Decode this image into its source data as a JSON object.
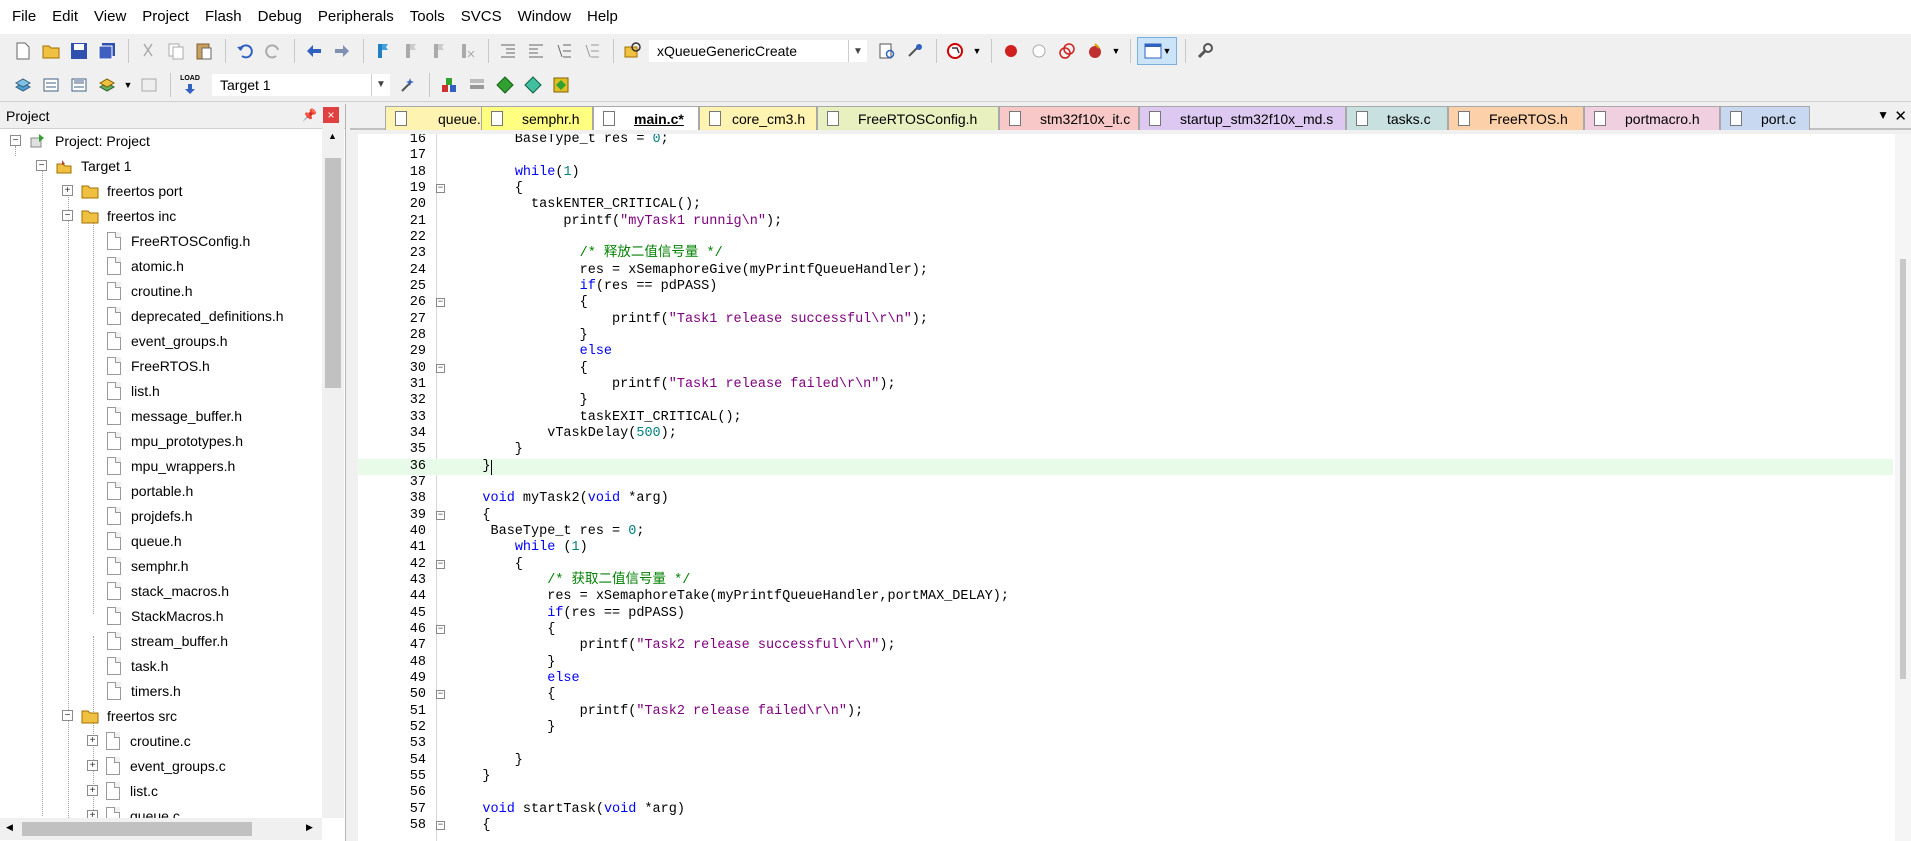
{
  "menu": [
    "File",
    "Edit",
    "View",
    "Project",
    "Flash",
    "Debug",
    "Peripherals",
    "Tools",
    "SVCS",
    "Window",
    "Help"
  ],
  "toolbar1": {
    "find_combo": "xQueueGenericCreate"
  },
  "toolbar2": {
    "target_combo": "Target 1",
    "load_label": "LOAD"
  },
  "project": {
    "title": "Project",
    "root": "Project: Project",
    "target": "Target 1",
    "folders": {
      "port": "freertos port",
      "inc": "freertos inc",
      "src": "freertos src"
    },
    "inc_files": [
      "FreeRTOSConfig.h",
      "atomic.h",
      "croutine.h",
      "deprecated_definitions.h",
      "event_groups.h",
      "FreeRTOS.h",
      "list.h",
      "message_buffer.h",
      "mpu_prototypes.h",
      "mpu_wrappers.h",
      "portable.h",
      "projdefs.h",
      "queue.h",
      "semphr.h",
      "stack_macros.h",
      "StackMacros.h",
      "stream_buffer.h",
      "task.h",
      "timers.h"
    ],
    "src_files": [
      "croutine.c",
      "event_groups.c",
      "list.c",
      "queue.c"
    ]
  },
  "tabs": [
    {
      "label": "queue.c",
      "color": "#fef3b0"
    },
    {
      "label": "semphr.h",
      "color": "#fefe80"
    },
    {
      "label": "main.c*",
      "color": "#ffffff"
    },
    {
      "label": "core_cm3.h",
      "color": "#fef3b0"
    },
    {
      "label": "FreeRTOSConfig.h",
      "color": "#e8f0c0"
    },
    {
      "label": "stm32f10x_it.c",
      "color": "#f8c8c8"
    },
    {
      "label": "startup_stm32f10x_md.s",
      "color": "#dcc8f0"
    },
    {
      "label": "tasks.c",
      "color": "#c8e0e0"
    },
    {
      "label": "FreeRTOS.h",
      "color": "#fcd0a8"
    },
    {
      "label": "portmacro.h",
      "color": "#f0d0e0"
    },
    {
      "label": "port.c",
      "color": "#c8d8f0"
    }
  ],
  "code": [
    {
      "n": "16",
      "t": "        BaseType_t res = 0;"
    },
    {
      "n": "17",
      "t": ""
    },
    {
      "n": "18",
      "t": "        while(1)"
    },
    {
      "n": "19",
      "t": "        {",
      "fold": true
    },
    {
      "n": "20",
      "t": "          taskENTER_CRITICAL();"
    },
    {
      "n": "21",
      "t": "              printf(\"myTask1 runnig\\n\");"
    },
    {
      "n": "22",
      "t": ""
    },
    {
      "n": "23",
      "t": "                /* 释放二值信号量 */"
    },
    {
      "n": "24",
      "t": "                res = xSemaphoreGive(myPrintfQueueHandler);"
    },
    {
      "n": "25",
      "t": "                if(res == pdPASS)"
    },
    {
      "n": "26",
      "t": "                {",
      "fold": true
    },
    {
      "n": "27",
      "t": "                    printf(\"Task1 release successful\\r\\n\");"
    },
    {
      "n": "28",
      "t": "                }"
    },
    {
      "n": "29",
      "t": "                else"
    },
    {
      "n": "30",
      "t": "                {",
      "fold": true
    },
    {
      "n": "31",
      "t": "                    printf(\"Task1 release failed\\r\\n\");"
    },
    {
      "n": "32",
      "t": "                }"
    },
    {
      "n": "33",
      "t": "                taskEXIT_CRITICAL();"
    },
    {
      "n": "34",
      "t": "            vTaskDelay(500);"
    },
    {
      "n": "35",
      "t": "        }"
    },
    {
      "n": "36",
      "t": "    }",
      "hl": true
    },
    {
      "n": "37",
      "t": ""
    },
    {
      "n": "38",
      "t": "    void myTask2(void *arg)"
    },
    {
      "n": "39",
      "t": "    {",
      "fold": true
    },
    {
      "n": "40",
      "t": "     BaseType_t res = 0;"
    },
    {
      "n": "41",
      "t": "        while (1)"
    },
    {
      "n": "42",
      "t": "        {",
      "fold": true
    },
    {
      "n": "43",
      "t": "            /* 获取二值信号量 */"
    },
    {
      "n": "44",
      "t": "            res = xSemaphoreTake(myPrintfQueueHandler,portMAX_DELAY);"
    },
    {
      "n": "45",
      "t": "            if(res == pdPASS)"
    },
    {
      "n": "46",
      "t": "            {",
      "fold": true
    },
    {
      "n": "47",
      "t": "                printf(\"Task2 release successful\\r\\n\");"
    },
    {
      "n": "48",
      "t": "            }"
    },
    {
      "n": "49",
      "t": "            else"
    },
    {
      "n": "50",
      "t": "            {",
      "fold": true
    },
    {
      "n": "51",
      "t": "                printf(\"Task2 release failed\\r\\n\");"
    },
    {
      "n": "52",
      "t": "            }"
    },
    {
      "n": "53",
      "t": ""
    },
    {
      "n": "54",
      "t": "        }"
    },
    {
      "n": "55",
      "t": "    }"
    },
    {
      "n": "56",
      "t": ""
    },
    {
      "n": "57",
      "t": "    void startTask(void *arg)"
    },
    {
      "n": "58",
      "t": "    {",
      "fold": true
    }
  ]
}
